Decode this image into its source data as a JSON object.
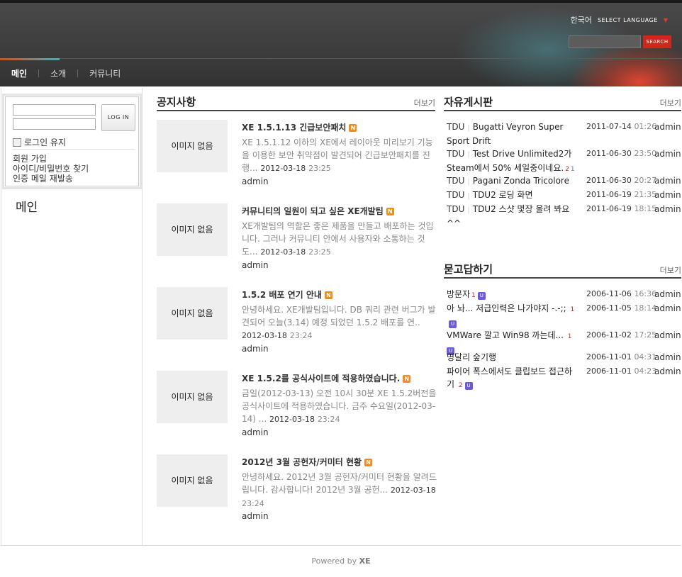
{
  "header": {
    "current_language": "한국어",
    "select_language_label": "SELECT LANGUAGE",
    "search_button_label": "SEARCH"
  },
  "gnb": {
    "items": [
      "메인",
      "소개",
      "커뮤니티"
    ]
  },
  "login": {
    "button_label": "LOG IN",
    "keep_login_label": "로그인 유지",
    "links": [
      "회원 가입",
      "아이디/비밀번호 찾기",
      "인증 메일 재발송"
    ]
  },
  "page_title": "메인",
  "notice": {
    "title": "공지사항",
    "more": "더보기",
    "no_image": "이미지 없음",
    "posts": [
      {
        "title": "XE 1.5.1.13 긴급보안패치",
        "summary": "XE 1.5.1.12 이하의 XE에서 레이아웃 미리보기 기능을 이용한 보안 취약점이 발견되어 긴급보안패치를 진행...",
        "date": "2012-03-18",
        "time": "23:25",
        "author": "admin"
      },
      {
        "title": "커뮤니티의 일원이 되고 싶은 XE개발팀",
        "summary": "XE개발팀의 역할은 좋은 제품을 만들고 배포하는 것입니다. 그러나 커뮤니티 안에서 사용자와 소통하는 것도...",
        "date": "2012-03-18",
        "time": "23:25",
        "author": "admin"
      },
      {
        "title": "1.5.2 배포 연기 안내",
        "summary": "안녕하세요. XE개발팀입니다. DB 쿼리 관련 버그가 발견되어 오늘(3.14) 예정 되었던 1.5.2 배포를 연..",
        "date": "2012-03-18",
        "time": "23:24",
        "author": "admin"
      },
      {
        "title": "XE 1.5.2를 공식사이트에 적용하였습니다.",
        "summary": "금일(2012-03-13) 오전 10시 30분 XE 1.5.2버전을 공식사이트에 적용하였습니다. 금주 수요일(2012-03-14) ...",
        "date": "2012-03-18",
        "time": "23:24",
        "author": "admin"
      },
      {
        "title": "2012년 3월 공헌자/커미터 현황",
        "summary": "안녕하세요. 2012년 3월 공헌자/커미터 현황을 알려드립니다. 감사합니다! 2012년 3월 공헌...",
        "date": "2012-03-18",
        "time": "23:24",
        "author": "admin"
      }
    ]
  },
  "free_board": {
    "title": "자유게시판",
    "more": "더보기",
    "posts": [
      {
        "category": "TDU",
        "title": "Bugatti Veyron Super Sport Drift",
        "comments": "",
        "trackbacks": "",
        "date": "2011-07-14",
        "time": "01:26",
        "author": "admin"
      },
      {
        "category": "TDU",
        "title": "Test Drive Unlimited2가 Steam에서 50% 세일중이네요.",
        "comments": "2",
        "trackbacks": "1",
        "date": "2011-06-30",
        "time": "23:50",
        "author": "admin"
      },
      {
        "category": "TDU",
        "title": "Pagani Zonda Tricolore",
        "comments": "",
        "trackbacks": "",
        "date": "2011-06-30",
        "time": "20:27",
        "author": "admin"
      },
      {
        "category": "TDU",
        "title": "TDU2 로딩 화면",
        "comments": "",
        "trackbacks": "",
        "date": "2011-06-19",
        "time": "21:35",
        "author": "admin"
      },
      {
        "category": "TDU",
        "title": "TDU2 스샷 몇장 올려 봐요 ^^",
        "comments": "",
        "trackbacks": "",
        "date": "2011-06-19",
        "time": "18:15",
        "author": "admin"
      }
    ]
  },
  "qna": {
    "title": "묻고답하기",
    "more": "더보기",
    "posts": [
      {
        "title": "방문자",
        "comments": "1",
        "date": "2006-11-06",
        "time": "16:36",
        "author": "admin"
      },
      {
        "title": "아 놔... 저급인력은 나가야지 -.-;;",
        "comments": "1",
        "date": "2006-11-05",
        "time": "18:14",
        "author": "admin"
      },
      {
        "title": "VMWare 깔고 Win98 까는데...",
        "comments": "1",
        "date": "2006-11-02",
        "time": "17:25",
        "author": "admin"
      },
      {
        "title": "명달리 숲기행",
        "comments": "",
        "date": "2006-11-01",
        "time": "04:31",
        "author": "admin"
      },
      {
        "title": "파이어 폭스에서도 클립보드 접근하기",
        "comments": "2",
        "date": "2006-11-01",
        "time": "04:23",
        "author": "admin"
      }
    ],
    "updated_badge": "U"
  },
  "footer": {
    "powered_by": "Powered by",
    "brand": "XE"
  },
  "new_badge": "N"
}
